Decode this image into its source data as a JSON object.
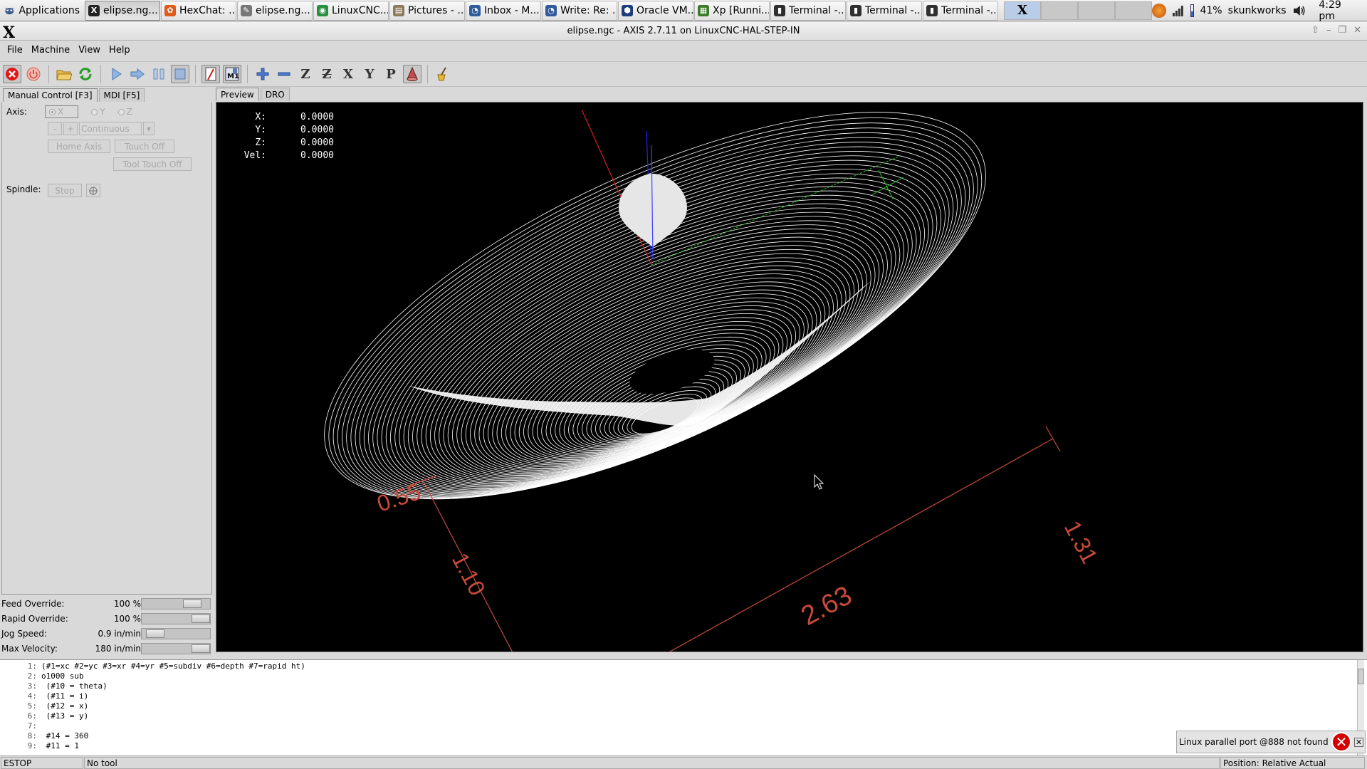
{
  "taskbar": {
    "apps_label": "Applications",
    "tasks": [
      {
        "label": "elipse.ng...",
        "icon": "x-window-icon",
        "color": "#222222",
        "glyph": "X"
      },
      {
        "label": "HexChat: ...",
        "icon": "hexchat-icon",
        "color": "#e05a1c",
        "glyph": "✿"
      },
      {
        "label": "elipse.ng...",
        "icon": "text-editor-icon",
        "color": "#777777",
        "glyph": "✎"
      },
      {
        "label": "LinuxCNC...",
        "icon": "chrome-icon",
        "color": "#2a8f3f",
        "glyph": "◉"
      },
      {
        "label": "Pictures - ...",
        "icon": "folder-icon",
        "color": "#8a7a5a",
        "glyph": "▤"
      },
      {
        "label": "Inbox - M...",
        "icon": "thunderbird-icon",
        "color": "#315c9c",
        "glyph": "◔"
      },
      {
        "label": "Write: Re: ...",
        "icon": "thunderbird-write-icon",
        "color": "#315c9c",
        "glyph": "◔"
      },
      {
        "label": "Oracle VM...",
        "icon": "virtualbox-icon",
        "color": "#1c3d7a",
        "glyph": "⬢"
      },
      {
        "label": "Xp [Runni...",
        "icon": "windows-xp-icon",
        "color": "#3a7a2a",
        "glyph": "▦"
      },
      {
        "label": "Terminal -...",
        "icon": "terminal-icon",
        "color": "#2f2f2f",
        "glyph": "▮"
      },
      {
        "label": "Terminal -...",
        "icon": "terminal-icon",
        "color": "#2f2f2f",
        "glyph": "▮"
      },
      {
        "label": "Terminal -...",
        "icon": "terminal-icon",
        "color": "#2f2f2f",
        "glyph": "▮"
      }
    ],
    "battery_percent": "41%",
    "battery_level": 0.41,
    "hostname": "skunkworks",
    "clock": "4:29 pm"
  },
  "window": {
    "title": "elipse.ngc - AXIS 2.7.11 on LinuxCNC-HAL-STEP-IN"
  },
  "menu": {
    "file": "File",
    "machine": "Machine",
    "view": "View",
    "help": "Help"
  },
  "left": {
    "tab_manual": "Manual Control [F3]",
    "tab_mdi": "MDI [F5]",
    "axis_label": "Axis:",
    "axis_x": "X",
    "axis_y": "Y",
    "axis_z": "Z",
    "jog_minus": "-",
    "jog_plus": "+",
    "jog_mode": "Continuous",
    "home_axis": "Home Axis",
    "touch_off": "Touch Off",
    "tool_touch_off": "Tool Touch Off",
    "spindle_label": "Spindle:",
    "spindle_stop": "Stop"
  },
  "overrides": {
    "feed_label": "Feed Override:",
    "feed_value": "100 %",
    "rapid_label": "Rapid Override:",
    "rapid_value": "100 %",
    "jog_label": "Jog Speed:",
    "jog_value": "0.9 in/min",
    "maxvel_label": "Max Velocity:",
    "maxvel_value": "180 in/min"
  },
  "preview": {
    "tab_preview": "Preview",
    "tab_dro": "DRO",
    "dro": [
      {
        "label": "X:",
        "value": "0.0000"
      },
      {
        "label": "Y:",
        "value": "0.0000"
      },
      {
        "label": "Z:",
        "value": "0.0000"
      },
      {
        "label": "Vel:",
        "value": "0.0000"
      }
    ],
    "dimensions": {
      "top_left": "0.55",
      "left_side": "1.10",
      "bottom": "2.63",
      "right": "1.31"
    },
    "colors": {
      "background": "#000000",
      "toolpath": "#ffffff",
      "dimension": "#c84a3a",
      "axis_x": "#ff2020",
      "axis_y": "#20c020",
      "axis_z": "#2020ff"
    }
  },
  "gcode": {
    "lines": [
      {
        "n": "1:",
        "t": "(#1=xc #2=yc #3=xr #4=yr #5=subdiv #6=depth #7=rapid ht)"
      },
      {
        "n": "2:",
        "t": "o1000 sub"
      },
      {
        "n": "3:",
        "t": " (#10 = theta)"
      },
      {
        "n": "4:",
        "t": " (#11 = i)"
      },
      {
        "n": "5:",
        "t": " (#12 = x)"
      },
      {
        "n": "6:",
        "t": " (#13 = y)"
      },
      {
        "n": "7:",
        "t": ""
      },
      {
        "n": "8:",
        "t": " #14 = 360"
      },
      {
        "n": "9:",
        "t": " #11 = 1"
      }
    ]
  },
  "notification": {
    "message": "Linux parallel port @888 not found"
  },
  "status": {
    "state": "ESTOP",
    "tool": "No tool",
    "position": "Position: Relative Actual"
  }
}
